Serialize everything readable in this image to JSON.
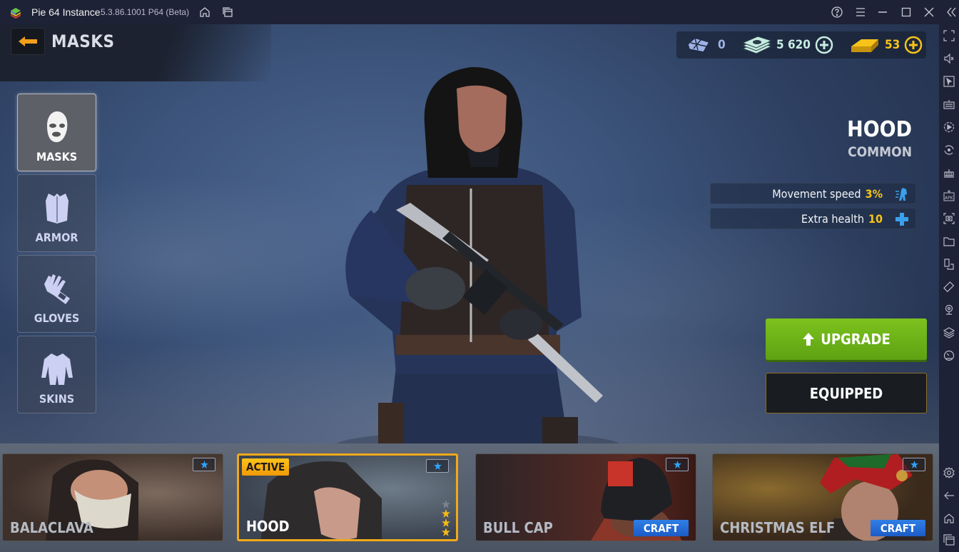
{
  "window": {
    "app_title": "Pie 64 Instance",
    "version": "5.3.86.1001 P64 (Beta)",
    "titlebar_icons": [
      "home-icon",
      "multi-instance-icon",
      "help-icon",
      "menu-icon",
      "minimize-icon",
      "maximize-icon",
      "close-icon",
      "collapse-sidebar-icon"
    ]
  },
  "sidebar_tools": [
    "fullscreen-icon",
    "volume-mute-icon",
    "pointer-icon",
    "keyboard-icon",
    "macro-record-icon",
    "rotate-sync-icon",
    "build-icon",
    "apk-install-icon",
    "screenshot-icon",
    "folder-icon",
    "multi-window-icon",
    "rotate-icon",
    "location-icon",
    "layers-icon",
    "performance-icon"
  ],
  "sidebar_bottom_tools": [
    "settings-icon",
    "back-icon",
    "home-icon",
    "recent-apps-icon"
  ],
  "header": {
    "title": "MASKS",
    "back_icon": "arrow-left-icon"
  },
  "currency": {
    "tickets": "0",
    "cash": "5 620",
    "gold": "53",
    "colors": {
      "tickets": "#9fb2e6",
      "cash": "#c6ece0",
      "gold": "#f7c318"
    }
  },
  "categories": [
    {
      "label": "MASKS",
      "icon": "mask-icon",
      "active": true
    },
    {
      "label": "ARMOR",
      "icon": "vest-icon",
      "active": false
    },
    {
      "label": "GLOVES",
      "icon": "glove-icon",
      "active": false
    },
    {
      "label": "SKINS",
      "icon": "suit-icon",
      "active": false
    }
  ],
  "item": {
    "name": "HOOD",
    "rarity": "COMMON",
    "stats": [
      {
        "label": "Movement speed",
        "value": "3%",
        "icon": "running-icon"
      },
      {
        "label": "Extra health",
        "value": "10",
        "icon": "health-plus-icon"
      }
    ]
  },
  "actions": {
    "upgrade": "UPGRADE",
    "equipped": "EQUIPPED"
  },
  "cards": [
    {
      "name": "BALACLAVA",
      "active": false,
      "craft": null,
      "stars": null
    },
    {
      "name": "HOOD",
      "active": true,
      "badge": "ACTIVE",
      "craft": null,
      "stars": {
        "filled": 3,
        "total": 4
      }
    },
    {
      "name": "BULL CAP",
      "active": false,
      "craft": "CRAFT",
      "stars": null
    },
    {
      "name": "CHRISTMAS ELF",
      "active": false,
      "craft": "CRAFT",
      "stars": null
    }
  ]
}
